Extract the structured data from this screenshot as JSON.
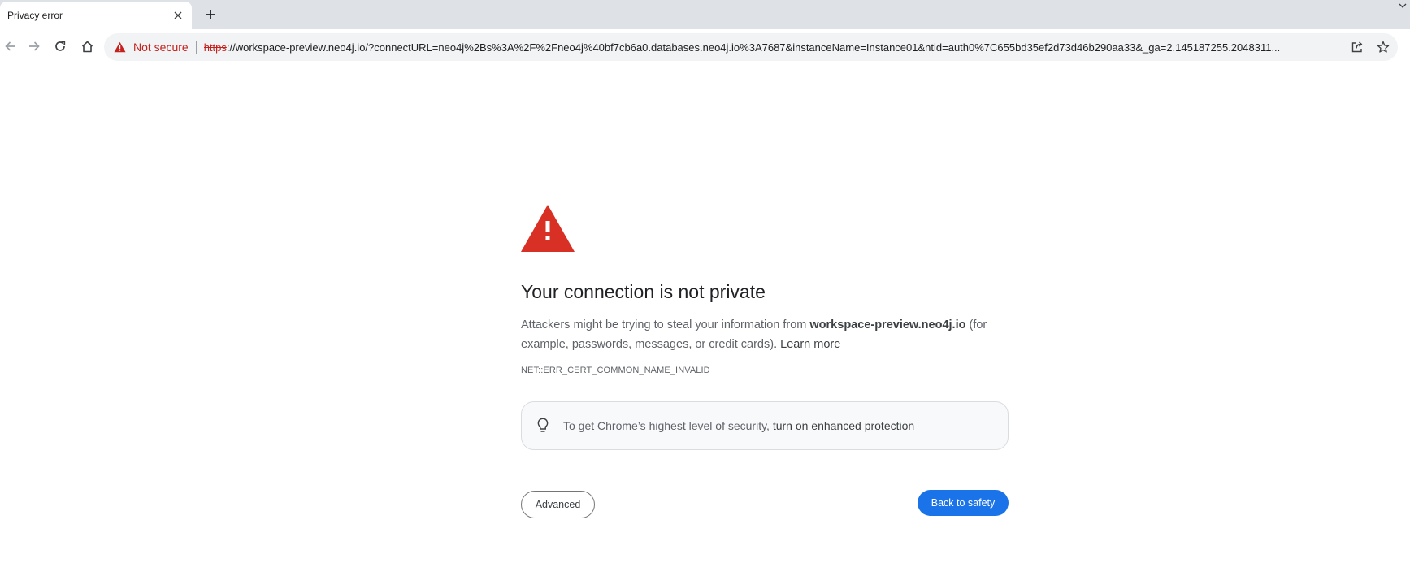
{
  "tabs": [
    {
      "title": "Privacy error",
      "close_icon": "close-icon"
    }
  ],
  "toolbar": {
    "security_chip": "Not secure",
    "url_scheme": "https",
    "url_rest": "://workspace-preview.neo4j.io/?connectURL=neo4j%2Bs%3A%2F%2Fneo4j%40bf7cb6a0.databases.neo4j.io%3A7687&instanceName=Instance01&ntid=auth0%7C655bd35ef2d73d46b290aa33&_ga=2.145187255.2048311..."
  },
  "interstitial": {
    "heading": "Your connection is not private",
    "explanation_prefix": "Attackers might be trying to steal your information from ",
    "domain": "workspace-preview.neo4j.io",
    "explanation_suffix": " (for example, passwords, messages, or credit cards). ",
    "learn_more": "Learn more",
    "error_code": "NET::ERR_CERT_COMMON_NAME_INVALID",
    "enhanced_prefix": "To get Chrome’s highest level of security, ",
    "enhanced_link": "turn on enhanced protection",
    "advanced_button": "Advanced",
    "safety_button": "Back to safety"
  },
  "colors": {
    "accent": "#1a73e8",
    "warning_red": "#d93025",
    "not_secure_red": "#c5221f"
  }
}
